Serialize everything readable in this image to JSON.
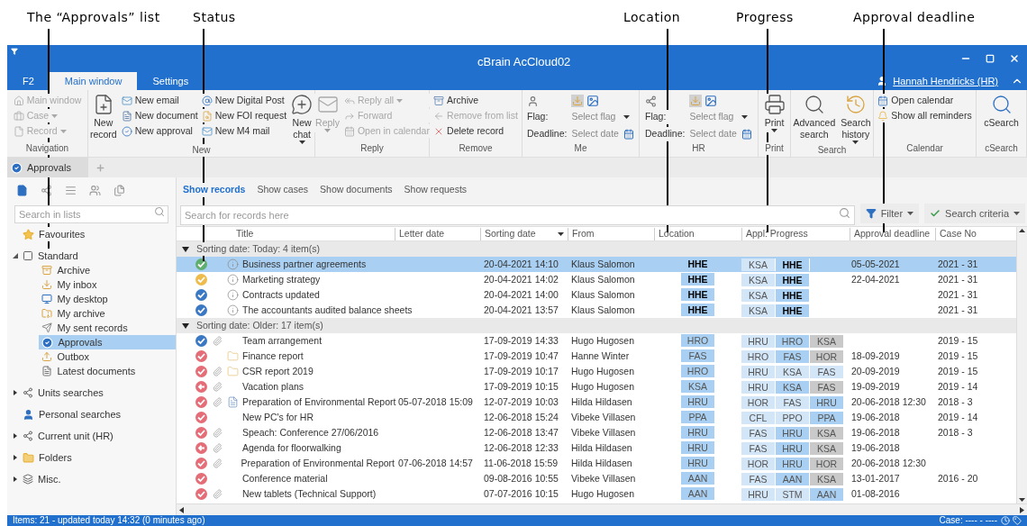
{
  "callouts": [
    {
      "label": "The “Approvals” list"
    },
    {
      "label": "Status"
    },
    {
      "label": "Location"
    },
    {
      "label": "Progress"
    },
    {
      "label": "Approval deadline"
    }
  ],
  "window": {
    "title": "cBrain AcCloud02"
  },
  "menu_tabs": [
    {
      "label": "F2",
      "selected": false
    },
    {
      "label": "Main window",
      "selected": true
    },
    {
      "label": "Settings",
      "selected": false
    }
  ],
  "user": {
    "name": "Hannah Hendricks (HR)"
  },
  "ribbon": [
    {
      "label": "Navigation",
      "kind": "buttons",
      "items": [
        {
          "label": "Main window",
          "kind": "small",
          "disabled": true
        },
        {
          "label": "Case",
          "kind": "small",
          "disabled": true,
          "dropdown": true
        },
        {
          "label": "Record",
          "kind": "small",
          "disabled": true,
          "dropdown": true
        }
      ]
    },
    {
      "label": "New",
      "kind": "buttons",
      "items": [
        {
          "label": "New record",
          "kind": "large",
          "disabled": false
        },
        {
          "label": "New email",
          "kind": "small",
          "disabled": false
        },
        {
          "label": "New document",
          "kind": "small",
          "disabled": false
        },
        {
          "label": "New approval",
          "kind": "small",
          "disabled": false
        },
        {
          "label": "New Digital Post",
          "kind": "small",
          "disabled": false
        },
        {
          "label": "New FOI request",
          "kind": "small",
          "disabled": false
        },
        {
          "label": "New M4 mail",
          "kind": "small",
          "disabled": false
        },
        {
          "label": "New chat",
          "kind": "large",
          "disabled": false,
          "dropdown": true
        }
      ]
    },
    {
      "label": "Reply",
      "kind": "buttons",
      "items": [
        {
          "label": "Reply",
          "kind": "large",
          "disabled": true,
          "dropdown": true
        },
        {
          "label": "Reply all",
          "kind": "small",
          "disabled": true,
          "dropdown": true
        },
        {
          "label": "Forward",
          "kind": "small",
          "disabled": true
        },
        {
          "label": "Open in calendar",
          "kind": "small",
          "disabled": true
        }
      ]
    },
    {
      "label": "Remove",
      "kind": "buttons",
      "items": [
        {
          "label": "Archive",
          "kind": "small",
          "disabled": false
        },
        {
          "label": "Remove from list",
          "kind": "small",
          "disabled": true
        },
        {
          "label": "Delete record",
          "kind": "small",
          "disabled": false
        }
      ]
    },
    {
      "label": "Me",
      "kind": "flags",
      "flag": {
        "label": "Flag:",
        "placeholder": "Select flag"
      },
      "deadline": {
        "label": "Deadline:",
        "placeholder": "Select date"
      }
    },
    {
      "label": "HR",
      "kind": "flags",
      "flag": {
        "label": "Flag:",
        "placeholder": "Select flag"
      },
      "deadline": {
        "label": "Deadline:",
        "placeholder": "Select date"
      }
    },
    {
      "label": "Print",
      "kind": "buttons",
      "items": [
        {
          "label": "Print",
          "kind": "large",
          "disabled": false,
          "dropdown": true
        }
      ]
    },
    {
      "label": "Search",
      "kind": "buttons",
      "items": [
        {
          "label": "Advanced search",
          "kind": "large",
          "disabled": false
        },
        {
          "label": "Search history",
          "kind": "large",
          "disabled": false,
          "dropdown": true
        }
      ]
    },
    {
      "label": "Calendar",
      "kind": "buttons",
      "items": [
        {
          "label": "Open calendar",
          "kind": "small",
          "disabled": false
        },
        {
          "label": "Show all reminders",
          "kind": "small",
          "disabled": false
        }
      ]
    },
    {
      "label": "cSearch",
      "kind": "buttons",
      "items": [
        {
          "label": "cSearch",
          "kind": "large",
          "disabled": false
        }
      ]
    }
  ],
  "doc_tabs": [
    {
      "label": "Approvals",
      "selected": true
    }
  ],
  "sidebar": {
    "search": {
      "placeholder": "Search in lists"
    },
    "tree": [
      {
        "label": "Favourites",
        "selected": false
      },
      {
        "label": "Standard",
        "selected": false,
        "expanded": true,
        "children": [
          {
            "label": "Archive",
            "selected": false
          },
          {
            "label": "My inbox",
            "selected": false
          },
          {
            "label": "My desktop",
            "selected": false
          },
          {
            "label": "My archive",
            "selected": false
          },
          {
            "label": "My sent records",
            "selected": false
          },
          {
            "label": "Approvals",
            "selected": true
          },
          {
            "label": "Outbox",
            "selected": false
          },
          {
            "label": "Latest documents",
            "selected": false
          }
        ]
      },
      {
        "label": "Units searches",
        "selected": false,
        "expanded": false
      },
      {
        "label": "Personal searches",
        "selected": false
      },
      {
        "label": "Current unit (HR)",
        "selected": false,
        "expanded": false
      },
      {
        "label": "Folders",
        "selected": false,
        "expanded": false
      },
      {
        "label": "Misc.",
        "selected": false,
        "expanded": false
      }
    ]
  },
  "view_tabs": [
    {
      "label": "Show records",
      "selected": true
    },
    {
      "label": "Show cases",
      "selected": false
    },
    {
      "label": "Show documents",
      "selected": false
    },
    {
      "label": "Show requests",
      "selected": false
    }
  ],
  "record_search": {
    "placeholder": "Search for records here"
  },
  "filter_button": "Filter",
  "criteria_button": "Search criteria",
  "table": {
    "columns": [
      "Title",
      "Letter date",
      "Sorting date",
      "From",
      "Location",
      "Appl: Progress",
      "Approval deadline",
      "Case No"
    ],
    "groups": [
      {
        "label": "Sorting date: Today: 4 item(s)",
        "expanded": true,
        "rows": [
          {
            "selected": true,
            "status": {
              "kind": "check",
              "color": "#5fae6e"
            },
            "attachment": false,
            "doc_icon": {
              "kind": "info"
            },
            "title": "Business partner agreements",
            "sorting_date": "20-04-2021 14:10",
            "from": "Klaus Salomon",
            "location": "HHE",
            "bold": true,
            "progress": [
              {
                "unit": "KSA",
                "kind": "done"
              },
              {
                "unit": "HHE",
                "kind": "current"
              }
            ],
            "deadline": "05-05-2021",
            "case_no": "2021 - 31"
          },
          {
            "selected": false,
            "status": {
              "kind": "check",
              "color": "#eebb4d"
            },
            "attachment": false,
            "doc_icon": {
              "kind": "info"
            },
            "title": "Marketing strategy",
            "sorting_date": "20-04-2021 14:02",
            "from": "Klaus Salomon",
            "location": "HHE",
            "bold": true,
            "progress": [
              {
                "unit": "KSA",
                "kind": "done"
              },
              {
                "unit": "HHE",
                "kind": "current"
              }
            ],
            "deadline": "22-04-2021",
            "case_no": "2021 - 31"
          },
          {
            "selected": false,
            "status": {
              "kind": "check",
              "color": "#3b78c3"
            },
            "attachment": false,
            "doc_icon": {
              "kind": "info"
            },
            "title": "Contracts updated",
            "sorting_date": "20-04-2021 14:00",
            "from": "Klaus Salomon",
            "location": "HHE",
            "bold": true,
            "progress": [
              {
                "unit": "KSA",
                "kind": "done"
              },
              {
                "unit": "HHE",
                "kind": "current"
              }
            ],
            "case_no": "2021 - 31"
          },
          {
            "selected": false,
            "status": {
              "kind": "check",
              "color": "#3b78c3"
            },
            "attachment": false,
            "doc_icon": {
              "kind": "info"
            },
            "title": "The accountants audited balance sheets",
            "sorting_date": "20-04-2021 13:57",
            "from": "Klaus Salomon",
            "location": "HHE",
            "bold": true,
            "progress": [
              {
                "unit": "KSA",
                "kind": "done"
              },
              {
                "unit": "HHE",
                "kind": "current"
              }
            ],
            "case_no": "2021 - 31"
          }
        ]
      },
      {
        "label": "Sorting date: Older: 17 item(s)",
        "expanded": true,
        "rows": [
          {
            "selected": false,
            "status": {
              "kind": "check",
              "color": "#3b78c3"
            },
            "attachment": true,
            "title": "Team arrangement",
            "sorting_date": "17-09-2019 14:33",
            "from": "Hugo Hugosen",
            "location": "HRO",
            "bold": false,
            "progress": [
              {
                "unit": "HRU",
                "kind": "done"
              },
              {
                "unit": "HRO",
                "kind": "current"
              },
              {
                "unit": "KSA",
                "kind": "pending"
              }
            ],
            "case_no": "2019 - 15"
          },
          {
            "selected": false,
            "status": {
              "kind": "check",
              "color": "#e46d78"
            },
            "attachment": false,
            "doc_icon": {
              "kind": "folder"
            },
            "title": "Finance report",
            "sorting_date": "17-09-2019 10:47",
            "from": "Hanne Winter",
            "location": "FAS",
            "bold": false,
            "progress": [
              {
                "unit": "HRO",
                "kind": "done"
              },
              {
                "unit": "FAS",
                "kind": "current"
              },
              {
                "unit": "HOR",
                "kind": "pending"
              }
            ],
            "deadline": "18-09-2019",
            "case_no": "2019 - 15"
          },
          {
            "selected": false,
            "status": {
              "kind": "check",
              "color": "#e46d78"
            },
            "attachment": true,
            "doc_icon": {
              "kind": "folder"
            },
            "title": "CSR report 2019",
            "sorting_date": "17-09-2019 10:17",
            "from": "Hugo Hugosen",
            "location": "HRO",
            "bold": false,
            "progress": [
              {
                "unit": "HRU",
                "kind": "done"
              },
              {
                "unit": "KSA",
                "kind": "done"
              },
              {
                "unit": "FAS",
                "kind": "done"
              }
            ],
            "deadline": "20-09-2019",
            "case_no": "2019 - 15"
          },
          {
            "selected": false,
            "status": {
              "kind": "return",
              "color": "#e46d78"
            },
            "attachment": true,
            "title": "Vacation plans",
            "sorting_date": "17-09-2019 10:15",
            "from": "Hugo Hugosen",
            "location": "KSA",
            "bold": false,
            "progress": [
              {
                "unit": "HRU",
                "kind": "done"
              },
              {
                "unit": "KSA",
                "kind": "current"
              },
              {
                "unit": "FAS",
                "kind": "pending"
              }
            ],
            "deadline": "19-09-2019",
            "case_no": "2019 - 14"
          },
          {
            "selected": false,
            "status": {
              "kind": "check",
              "color": "#e46d78"
            },
            "attachment": true,
            "doc_icon": {
              "kind": "document"
            },
            "title": "Preparation of Environmental Report",
            "letter_date": "05-07-2018 15:09",
            "sorting_date": "12-07-2019 10:03",
            "from": "Hilda Hildasen",
            "location": "HRU",
            "bold": false,
            "progress": [
              {
                "unit": "HOR",
                "kind": "done"
              },
              {
                "unit": "FAS",
                "kind": "done"
              },
              {
                "unit": "HRU",
                "kind": "current"
              }
            ],
            "deadline": "20-06-2018 12:30",
            "case_no": "2018 - 3"
          },
          {
            "selected": false,
            "status": {
              "kind": "check",
              "color": "#e46d78"
            },
            "attachment": false,
            "title": "New PC's for HR",
            "sorting_date": "12-06-2018 15:24",
            "from": "Vibeke Villasen",
            "location": "PPA",
            "bold": false,
            "progress": [
              {
                "unit": "CFL",
                "kind": "done"
              },
              {
                "unit": "PPO",
                "kind": "done"
              },
              {
                "unit": "PPA",
                "kind": "current"
              }
            ],
            "deadline": "19-06-2018",
            "case_no": "2019 - 14"
          },
          {
            "selected": false,
            "status": {
              "kind": "check",
              "color": "#e46d78"
            },
            "attachment": true,
            "title": "Speach: Conference 27/06/2016",
            "sorting_date": "12-06-2018 13:47",
            "from": "Vibeke Villasen",
            "location": "HRU",
            "bold": false,
            "progress": [
              {
                "unit": "FAS",
                "kind": "done"
              },
              {
                "unit": "HRU",
                "kind": "current"
              },
              {
                "unit": "KSA",
                "kind": "pending"
              }
            ],
            "deadline": "19-06-2018",
            "case_no": "2018 - 3"
          },
          {
            "selected": false,
            "status": {
              "kind": "return",
              "color": "#e46d78"
            },
            "attachment": true,
            "title": "Agenda for floorwalking",
            "sorting_date": "12-06-2018 12:33",
            "from": "Hilda Hildasen",
            "location": "HRU",
            "bold": false,
            "progress": [
              {
                "unit": "FAS",
                "kind": "done"
              },
              {
                "unit": "HRU",
                "kind": "current"
              },
              {
                "unit": "KSA",
                "kind": "pending"
              }
            ],
            "deadline": "19-06-2018"
          },
          {
            "selected": false,
            "status": {
              "kind": "check",
              "color": "#e46d78"
            },
            "attachment": true,
            "title": "Preparation of Environmental Report",
            "letter_date": "07-06-2018 14:57",
            "sorting_date": "11-06-2018 15:59",
            "from": "Hilda Hildasen",
            "location": "HRU",
            "bold": false,
            "progress": [
              {
                "unit": "HOR",
                "kind": "done"
              },
              {
                "unit": "HRU",
                "kind": "current"
              },
              {
                "unit": "HOR",
                "kind": "pending"
              }
            ],
            "deadline": "20-06-2018 12:30"
          },
          {
            "selected": false,
            "status": {
              "kind": "check",
              "color": "#e46d78"
            },
            "attachment": false,
            "title": "Conference material",
            "sorting_date": "09-08-2016 10:55",
            "from": "Vibeke Villasen",
            "location": "AAN",
            "bold": false,
            "progress": [
              {
                "unit": "FAS",
                "kind": "done"
              },
              {
                "unit": "AAN",
                "kind": "current"
              },
              {
                "unit": "KSA",
                "kind": "pending"
              }
            ],
            "deadline": "13-01-2017",
            "case_no": "2016 - 20"
          },
          {
            "selected": false,
            "status": {
              "kind": "check",
              "color": "#e46d78"
            },
            "attachment": true,
            "title": "New tablets (Technical Support)",
            "sorting_date": "07-07-2016 10:15",
            "from": "Hugo Hugosen",
            "location": "AAN",
            "bold": false,
            "progress": [
              {
                "unit": "HRU",
                "kind": "done"
              },
              {
                "unit": "STM",
                "kind": "done"
              },
              {
                "unit": "AAN",
                "kind": "current"
              }
            ],
            "deadline": "01-08-2016"
          }
        ]
      }
    ]
  },
  "status_bar": {
    "left": "Items: 21 - updated today 14:32 (0 minutes ago)",
    "right": "Case: ---- - ----"
  }
}
